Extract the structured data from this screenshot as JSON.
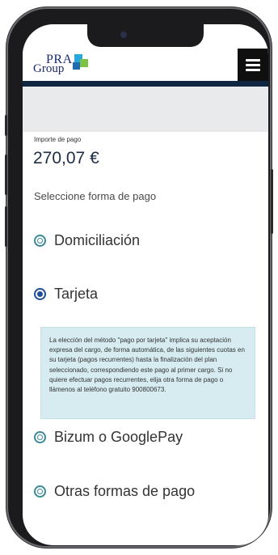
{
  "header": {
    "logo_pra": "PRA",
    "logo_group": "Group"
  },
  "payment": {
    "amount_label": "Importe de pago",
    "amount_value": "270,07 €",
    "select_label": "Seleccione forma de pago"
  },
  "options": [
    {
      "label": "Domiciliación",
      "selected": false
    },
    {
      "label": "Tarjeta",
      "selected": true
    },
    {
      "label": "Bizum o GooglePay",
      "selected": false
    },
    {
      "label": "Otras formas de pago",
      "selected": false
    }
  ],
  "card_notice": "La elección del método \"pago por tarjeta\" implica su aceptación expresa del cargo, de forma automática, de las siguientes cuotas en su tarjeta (pagos recurrentes) hasta la finalización del plan seleccionado, correspondiendo este pago al primer cargo. Si no quiere efectuar pagos recurrentes, elija otra forma de pago o llámenos al teléfono gratuito 900800673.",
  "colors": {
    "navy": "#0f2741",
    "accent": "#3c8a98",
    "selected": "#1e4f9a",
    "notice_bg": "#d6ecf0",
    "band": "#e8eaec"
  },
  "icons": [
    "hamburger-menu-icon",
    "radio-icon"
  ]
}
